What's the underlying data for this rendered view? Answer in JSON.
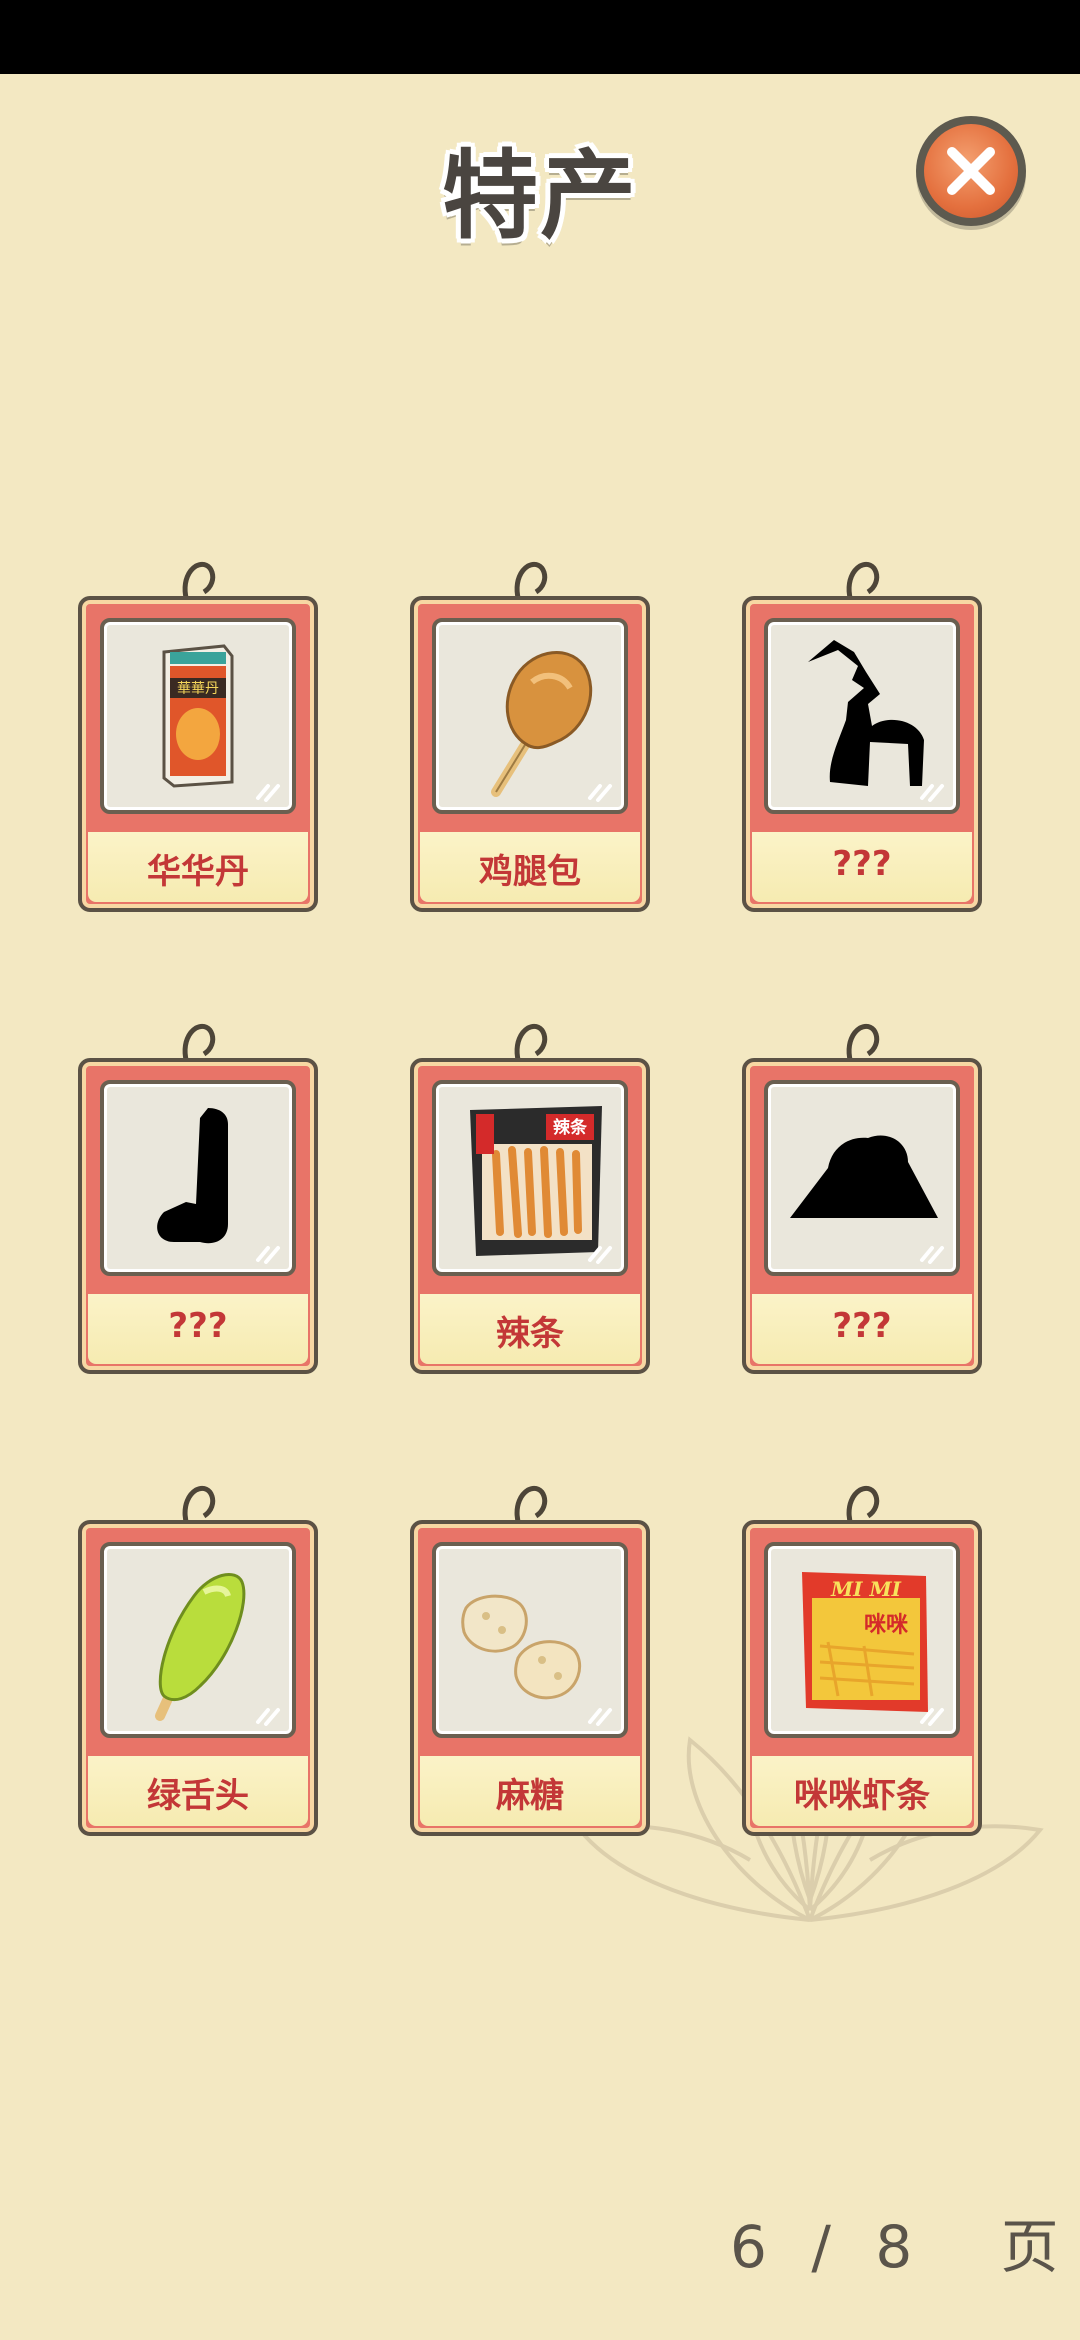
{
  "header": {
    "title": "特产",
    "close_icon": "close-icon"
  },
  "items": [
    {
      "label": "华华丹",
      "icon": "huahuadan-box"
    },
    {
      "label": "鸡腿包",
      "icon": "chicken-leg-snack"
    },
    {
      "label": "???",
      "icon": "locked-silhouette"
    },
    {
      "label": "???",
      "icon": "locked-silhouette"
    },
    {
      "label": "辣条",
      "icon": "latiao-package"
    },
    {
      "label": "???",
      "icon": "locked-silhouette"
    },
    {
      "label": "绿舌头",
      "icon": "green-popsicle"
    },
    {
      "label": "麻糖",
      "icon": "ma-tang-candy"
    },
    {
      "label": "咪咪虾条",
      "icon": "mimi-shrimp-chips"
    }
  ],
  "latiao_pack_text": "辣条",
  "mimi_pack_text": "MI MI",
  "mimi_pack_cn": "咪咪",
  "huahuadan_pack_text": "華華丹",
  "pager": {
    "current": "6",
    "separator": "/",
    "total": "8",
    "unit": "页"
  }
}
